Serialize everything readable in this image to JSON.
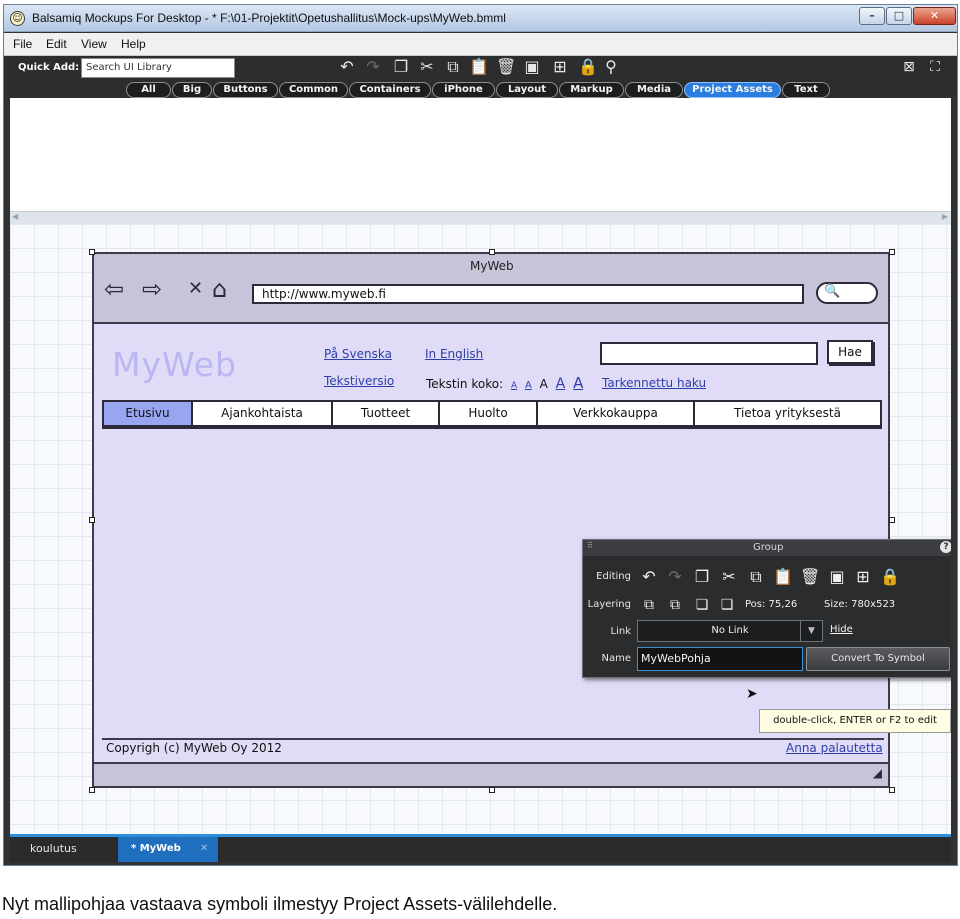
{
  "window": {
    "title": "Balsamiq Mockups For Desktop - * F:\\01-Projektit\\Opetushallitus\\Mock-ups\\MyWeb.bmml",
    "icon": "smiley-icon",
    "controls": {
      "minimize": "–",
      "maximize": "□",
      "close": "✕"
    }
  },
  "menu": [
    "File",
    "Edit",
    "View",
    "Help"
  ],
  "toolbar": {
    "quick_add_label": "Quick Add:",
    "search_placeholder": "Search UI Library",
    "icons": [
      "undo-icon",
      "redo-icon",
      "duplicate-icon",
      "cut-icon",
      "copy-icon",
      "paste-icon",
      "delete-icon",
      "group-icon",
      "ungroup-icon",
      "lock-icon",
      "search-icon"
    ]
  },
  "categories": [
    {
      "label": "All",
      "active": false
    },
    {
      "label": "Big",
      "active": false
    },
    {
      "label": "Buttons",
      "active": false
    },
    {
      "label": "Common",
      "active": false
    },
    {
      "label": "Containers",
      "active": false
    },
    {
      "label": "iPhone",
      "active": false
    },
    {
      "label": "Layout",
      "active": false
    },
    {
      "label": "Markup",
      "active": false
    },
    {
      "label": "Media",
      "active": false
    },
    {
      "label": "Project Assets",
      "active": true
    },
    {
      "label": "Text",
      "active": false
    }
  ],
  "mockup": {
    "window_title": "MyWeb",
    "url": "http://www.myweb.fi",
    "logo": "MyWeb",
    "links": {
      "swedish": "På Svenska",
      "english": "In English",
      "text_version": "Tekstiversio",
      "advanced_search": "Tarkennettu haku"
    },
    "text_size_label": "Tekstin koko:",
    "text_size_options": [
      "A",
      "A",
      "A",
      "A",
      "A"
    ],
    "search_button": "Hae",
    "tabs": [
      {
        "label": "Etusivu",
        "selected": true
      },
      {
        "label": "Ajankohtaista",
        "selected": false
      },
      {
        "label": "Tuotteet",
        "selected": false
      },
      {
        "label": "Huolto",
        "selected": false
      },
      {
        "label": "Verkkokauppa",
        "selected": false
      },
      {
        "label": "Tietoa yrityksestä",
        "selected": false
      }
    ],
    "copyright": "Copyrigh (c) MyWeb Oy  2012",
    "feedback_link": "Anna palautetta"
  },
  "group_panel": {
    "title": "Group",
    "help": "?",
    "editing_label": "Editing",
    "layering_label": "Layering",
    "pos": "Pos: 75,26",
    "size": "Size: 780x523",
    "link_label": "Link",
    "link_value": "No Link",
    "hide": "Hide",
    "name_label": "Name",
    "name_value": "MyWebPohja",
    "convert_button": "Convert To Symbol"
  },
  "tooltip": "double-click, ENTER or F2 to edit",
  "doc_tabs": [
    {
      "label": "koulutus",
      "active": false
    },
    {
      "label": "* MyWeb",
      "active": true
    }
  ],
  "doc_tab_close": "✕",
  "caption": "Nyt mallipohjaa vastaava symboli ilmestyy Project Assets-välilehdelle.",
  "colors": {
    "accent": "#2b7de0",
    "mockup_background": "#e0dcf7",
    "selected_tab": "#98a6f1",
    "toolbar_background": "#2c2d2f"
  }
}
